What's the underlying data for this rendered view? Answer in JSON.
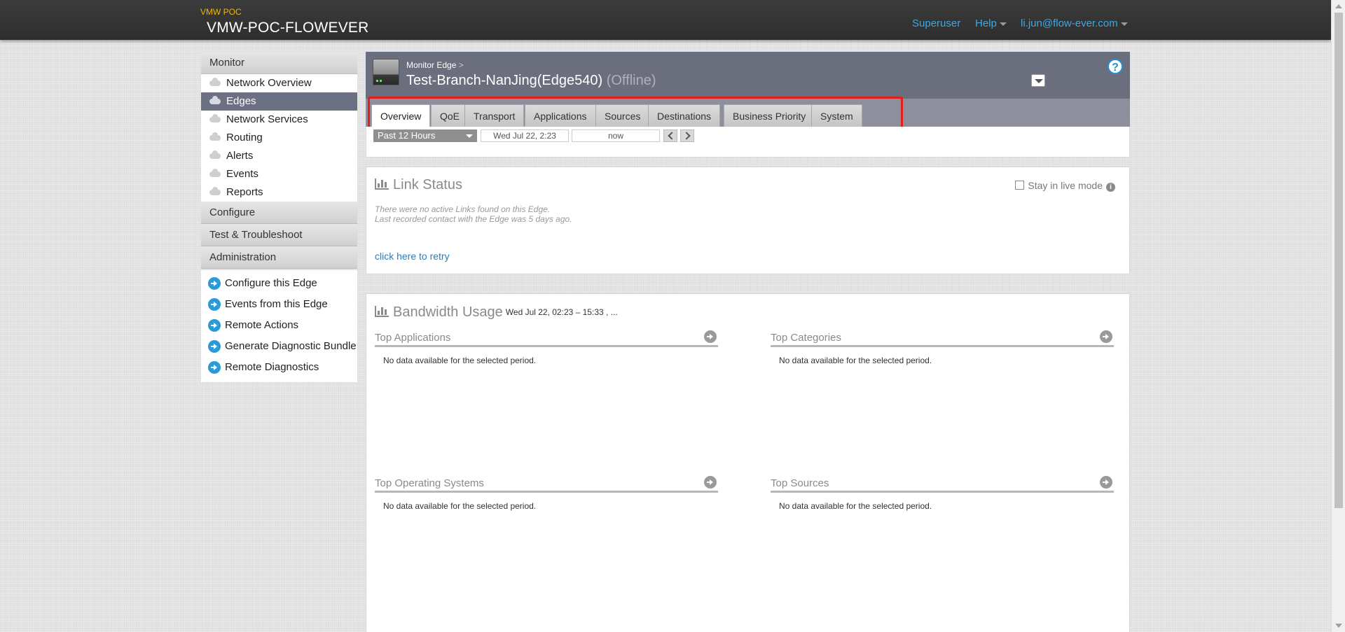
{
  "topbar": {
    "org_small": "VMW POC",
    "org_name": "VMW-POC-FLOWEVER",
    "superuser": "Superuser",
    "help": "Help",
    "user": "li.jun@flow-ever.com"
  },
  "sidebar": {
    "monitor_header": "Monitor",
    "monitor_items": [
      "Network Overview",
      "Edges",
      "Network Services",
      "Routing",
      "Alerts",
      "Events",
      "Reports"
    ],
    "configure_header": "Configure",
    "test_header": "Test & Troubleshoot",
    "admin_header": "Administration",
    "actions": [
      "Configure this Edge",
      "Events from this Edge",
      "Remote Actions",
      "Generate Diagnostic Bundle",
      "Remote Diagnostics"
    ]
  },
  "edge": {
    "breadcrumb": "Monitor Edge",
    "breadcrumb_sep": ">",
    "name": "Test-Branch-NanJing(Edge540)",
    "status": "(Offline)",
    "help_label": "?"
  },
  "tabs": [
    "Overview",
    "QoE",
    "Transport",
    "Applications",
    "Sources",
    "Destinations",
    "Business Priority",
    "System"
  ],
  "timebar": {
    "period": "Past 12 Hours",
    "start": "Wed Jul 22, 2:23",
    "end": "now"
  },
  "link_status": {
    "title": "Link Status",
    "live_mode": "Stay in live mode",
    "msg1": "There were no active Links found on this Edge.",
    "msg2": "Last recorded contact with the Edge was 5 days ago.",
    "retry": "click here to retry"
  },
  "bandwidth": {
    "title": "Bandwidth Usage",
    "range": "Wed Jul 22, 02:23 – 15:33 ,  ...",
    "top_applications": "Top Applications",
    "top_categories": "Top Categories",
    "top_os": "Top Operating Systems",
    "top_sources": "Top Sources",
    "no_data": "No data available for the selected period."
  },
  "colors": {
    "topbar": "#2e2e2e",
    "brand_accent": "#f2b705",
    "link_blue": "#3fa9e0",
    "sidebar_active": "#6b7083",
    "highlight": "#e21e1e"
  }
}
